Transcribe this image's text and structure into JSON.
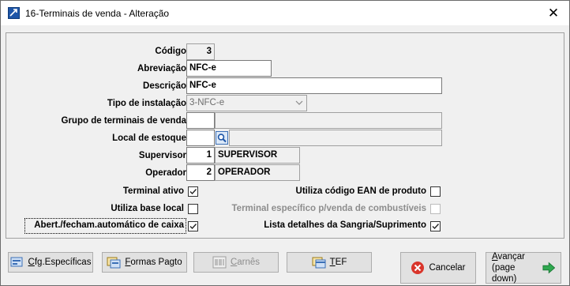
{
  "window": {
    "title": "16-Terminais de venda - Alteração",
    "close_glyph": "✕"
  },
  "form": {
    "codigo": {
      "label": "Código",
      "value": "3"
    },
    "abreviacao": {
      "label": "Abreviação",
      "value": "NFC-e"
    },
    "descricao": {
      "label": "Descrição",
      "value": "NFC-e"
    },
    "tipo_instalacao": {
      "label": "Tipo de instalação",
      "value": "3-NFC-e"
    },
    "grupo_terminais": {
      "label": "Grupo de terminais de venda",
      "value": "",
      "name": ""
    },
    "local_estoque": {
      "label": "Local de estoque",
      "value": "",
      "name": ""
    },
    "supervisor": {
      "label": "Supervisor",
      "value": "1",
      "name": "SUPERVISOR"
    },
    "operador": {
      "label": "Operador",
      "value": "2",
      "name": "OPERADOR"
    }
  },
  "checks": {
    "terminal_ativo": {
      "label": "Terminal ativo",
      "checked": true
    },
    "utiliza_base_local": {
      "label": "Utiliza base local",
      "checked": false
    },
    "abert_fecham": {
      "label": "Abert./fecham.automático de caixa",
      "checked": true
    },
    "utiliza_ean": {
      "label": "Utiliza código EAN de produto",
      "checked": false
    },
    "terminal_combustiveis": {
      "label": "Terminal específico p/venda de combustíveis",
      "checked": false,
      "enabled": false
    },
    "lista_detalhes": {
      "label": "Lista detalhes da Sangria/Suprimento",
      "checked": true
    }
  },
  "buttons": {
    "cfg_hot": "C",
    "cfg_rest": "fg.Específicas",
    "formas_hot": "F",
    "formas_rest": "ormas Pagto",
    "carnes_hot": "C",
    "carnes_rest": "arnês",
    "tef_hot": "T",
    "tef_rest": "EF",
    "cancelar": "Cancelar",
    "avancar_hot": "A",
    "avancar_rest": "vançar",
    "avancar_sub": "(page down)"
  },
  "colors": {
    "accent": "#1e56a8",
    "arrow_green": "#2fa84f",
    "cancel_red": "#d9352b"
  },
  "icons": [
    "app-icon",
    "close-icon",
    "chevron-down-icon",
    "search-icon",
    "checkmark-icon",
    "settings-icon",
    "payment-icon",
    "barcode-icon",
    "card-icon",
    "cancel-icon",
    "arrow-right-icon"
  ]
}
